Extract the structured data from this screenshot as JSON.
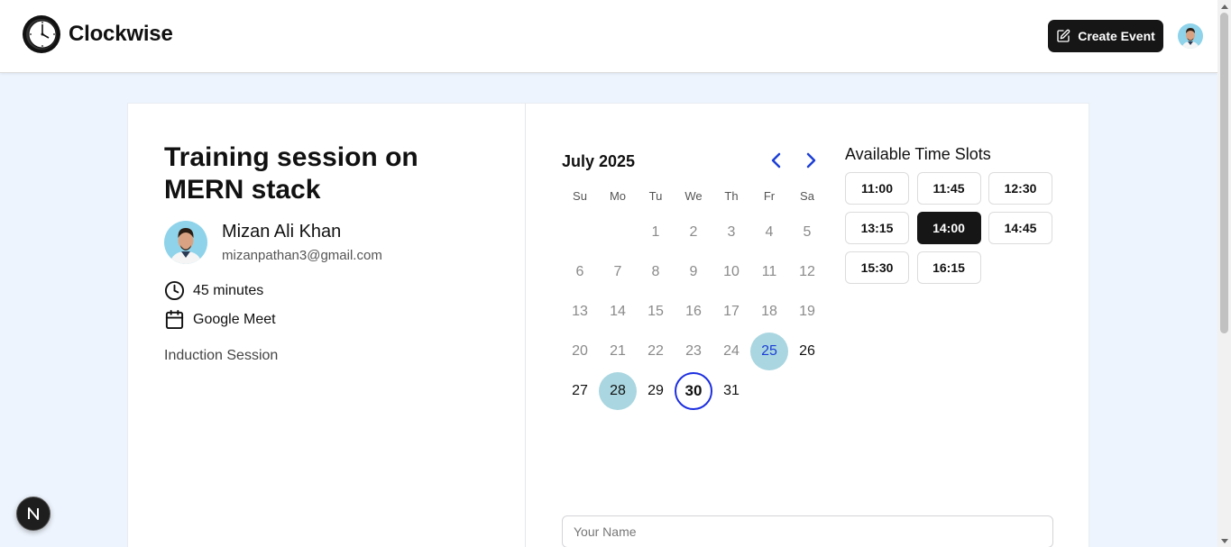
{
  "header": {
    "app_name": "Clockwise",
    "create_label": "Create Event"
  },
  "event": {
    "title": "Training session on MERN stack",
    "host_name": "Mizan Ali Khan",
    "host_email": "mizanpathan3@gmail.com",
    "duration": "45 minutes",
    "location": "Google Meet",
    "description": "Induction Session"
  },
  "calendar": {
    "month_label": "July 2025",
    "weekdays": [
      "Su",
      "Mo",
      "Tu",
      "We",
      "Th",
      "Fr",
      "Sa"
    ],
    "first_weekday_index": 2,
    "days_in_month": 31,
    "available_days": [
      25,
      28
    ],
    "selected_day": 30,
    "enabled_days": [
      26,
      27,
      29,
      31
    ],
    "colors": {
      "available_bg": "#a9d6e0",
      "selected_ring": "#1d2fe0",
      "available_text": "#1d3fd6"
    }
  },
  "slots": {
    "title": "Available Time Slots",
    "times": [
      "11:00",
      "11:45",
      "12:30",
      "13:15",
      "14:00",
      "14:45",
      "15:30",
      "16:15"
    ],
    "selected": "14:00"
  },
  "form": {
    "name_placeholder": "Your Name",
    "name_value": ""
  },
  "badge": {
    "letter": "N"
  }
}
